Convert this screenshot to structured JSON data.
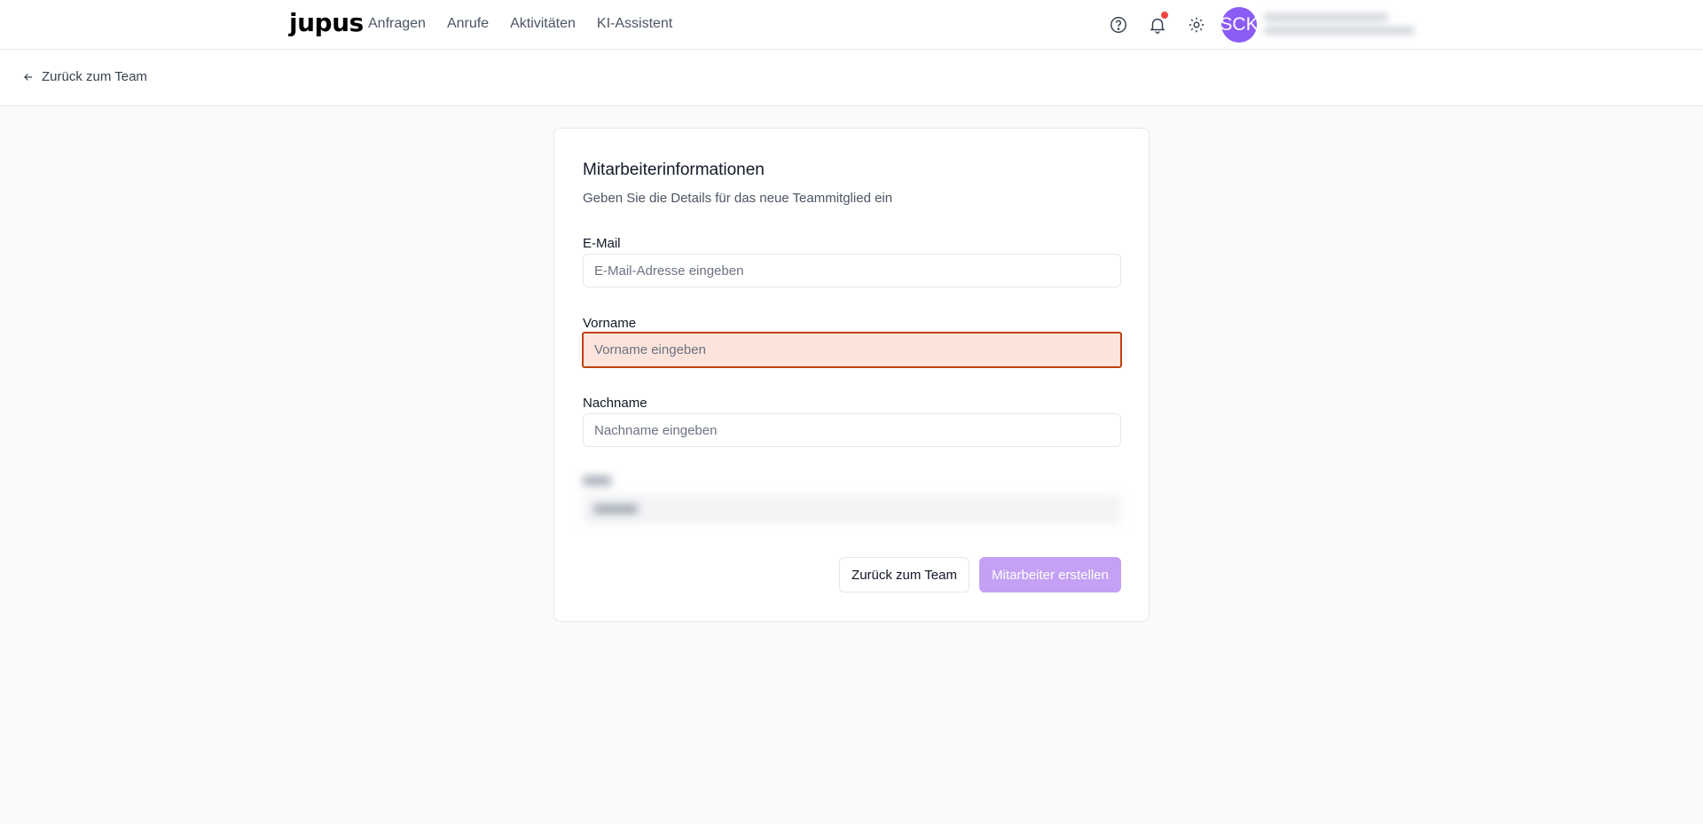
{
  "header": {
    "logo": "jupus",
    "nav": [
      "Anfragen",
      "Anrufe",
      "Aktivitäten",
      "KI-Assistent"
    ],
    "icons": [
      "help-icon",
      "bell-icon",
      "gear-icon"
    ],
    "avatar_initials": "SCK"
  },
  "subheader": {
    "back_label": "Zurück zum Team"
  },
  "form": {
    "title": "Mitarbeiterinformationen",
    "subtitle": "Geben Sie die Details für das neue Teammitglied ein",
    "email": {
      "label": "E-Mail",
      "placeholder": "E-Mail-Adresse eingeben",
      "value": ""
    },
    "firstname": {
      "label": "Vorname",
      "placeholder": "Vorname eingeben",
      "value": ""
    },
    "lastname": {
      "label": "Nachname",
      "placeholder": "Nachname eingeben",
      "value": ""
    },
    "cancel_label": "Zurück zum Team",
    "submit_label": "Mitarbeiter erstellen"
  },
  "colors": {
    "accent": "#8b5cf6",
    "button_primary_disabled": "#c4a1f5",
    "error_border": "#c2410c",
    "error_bg": "#fce4dc",
    "notification_dot": "#ef4444"
  }
}
